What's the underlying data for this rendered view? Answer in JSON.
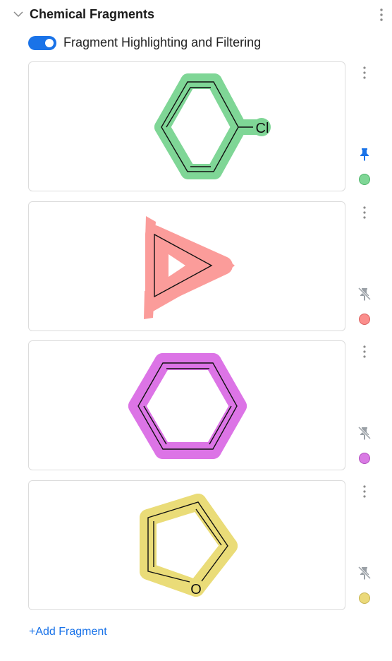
{
  "panel": {
    "title": "Chemical Fragments",
    "toggle_label": "Fragment Highlighting and Filtering",
    "toggle_on": true,
    "add_label": "+Add Fragment"
  },
  "fragments": [
    {
      "label": "Cl",
      "highlight_color": "#7fd696",
      "dot_color": "#7fd696",
      "dot_border": "#4fb46a",
      "pinned": true
    },
    {
      "label": "",
      "highlight_color": "#fb9c9a",
      "dot_color": "#fb8e8c",
      "dot_border": "#d9605e",
      "pinned": false
    },
    {
      "label": "",
      "highlight_color": "#dc74e6",
      "dot_color": "#d97ae4",
      "dot_border": "#b04fbd",
      "pinned": false
    },
    {
      "label": "O",
      "highlight_color": "#eadc78",
      "dot_color": "#ebd97a",
      "dot_border": "#c5b24f",
      "pinned": false
    }
  ],
  "colors": {
    "accent": "#1a73e8",
    "pin_inactive": "#9aa0a6",
    "bond": "#111111"
  }
}
